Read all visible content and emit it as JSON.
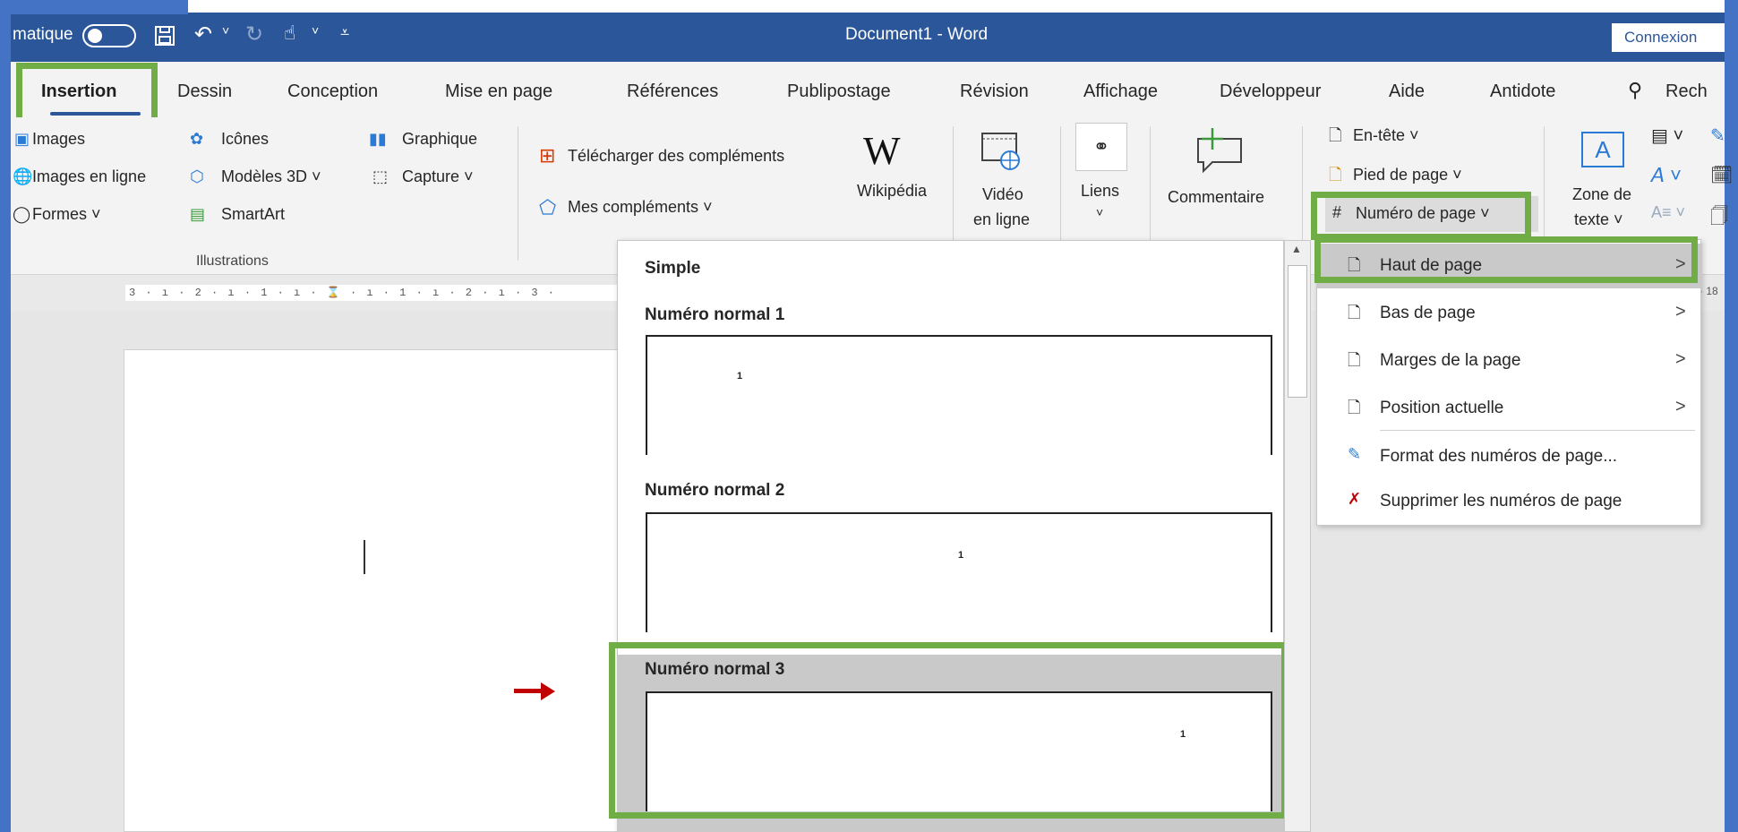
{
  "titlebar": {
    "autosave_label": "matique",
    "save_icon": "save-icon",
    "undo_icon": "undo-icon",
    "redo_icon": "redo-icon",
    "touch_icon": "touch-mode-icon",
    "customize_icon": "customize-qat-icon",
    "document_title": "Document1  -  Word",
    "connexion": "Connexion"
  },
  "tabs": [
    "Insertion",
    "Dessin",
    "Conception",
    "Mise en page",
    "Références",
    "Publipostage",
    "Révision",
    "Affichage",
    "Développeur",
    "Aide",
    "Antidote"
  ],
  "active_tab": "Insertion",
  "search_label": "Rech",
  "ribbon": {
    "illustrations": {
      "images": "Images",
      "images_en_ligne": "Images en ligne",
      "formes": "Formes ˅",
      "icones": "Icônes",
      "modeles_3d": "Modèles 3D  ˅",
      "smartart": "SmartArt",
      "graphique": "Graphique",
      "capture": "Capture ˅",
      "group_label": "Illustrations"
    },
    "complements": {
      "telecharger": "Télécharger des compléments",
      "mes_complements": "Mes compléments  ˅",
      "wikipedia": "Wikipédia",
      "wikipedia_glyph": "W"
    },
    "video_line1": "Vidéo",
    "video_line2": "en ligne",
    "liens": "Liens",
    "liens_chevron": "˅",
    "commentaire": "Commentaire",
    "entete": "En-tête ˅",
    "pied_de_page": "Pied de page ˅",
    "numero_de_page": "Numéro de page ˅",
    "zone_de_texte_line1": "Zone de",
    "zone_de_texte_line2": "texte ˅",
    "zone_glyph": "A"
  },
  "ruler": {
    "marks": "3 · ı · 2 · ı · 1 · ı · ⌛ · ı · 1 · ı · 2 · ı · 3 ·",
    "right_mark": "· 18"
  },
  "gallery": {
    "section": "Simple",
    "items": [
      {
        "title": "Numéro normal 1",
        "number": "1"
      },
      {
        "title": "Numéro normal 2",
        "number": "1"
      },
      {
        "title": "Numéro normal 3",
        "number": "1"
      }
    ]
  },
  "submenu": {
    "items": [
      {
        "label": "Haut de page",
        "icon": "page-top-icon",
        "has_arrow": true
      },
      {
        "label": "Bas de page",
        "icon": "page-bottom-icon",
        "has_arrow": true
      },
      {
        "label": "Marges de la page",
        "icon": "page-margins-icon",
        "has_arrow": true
      },
      {
        "label": "Position actuelle",
        "icon": "current-position-icon",
        "has_arrow": true
      },
      {
        "label": "Format des numéros de page...",
        "icon": "format-page-numbers-icon",
        "has_arrow": false
      },
      {
        "label": "Supprimer les numéros de page",
        "icon": "remove-page-numbers-icon",
        "has_arrow": false
      }
    ],
    "chevron": ">"
  },
  "highlight_color": "#70ad47",
  "accent_color": "#2b579a",
  "arrow_color": "#c00000"
}
